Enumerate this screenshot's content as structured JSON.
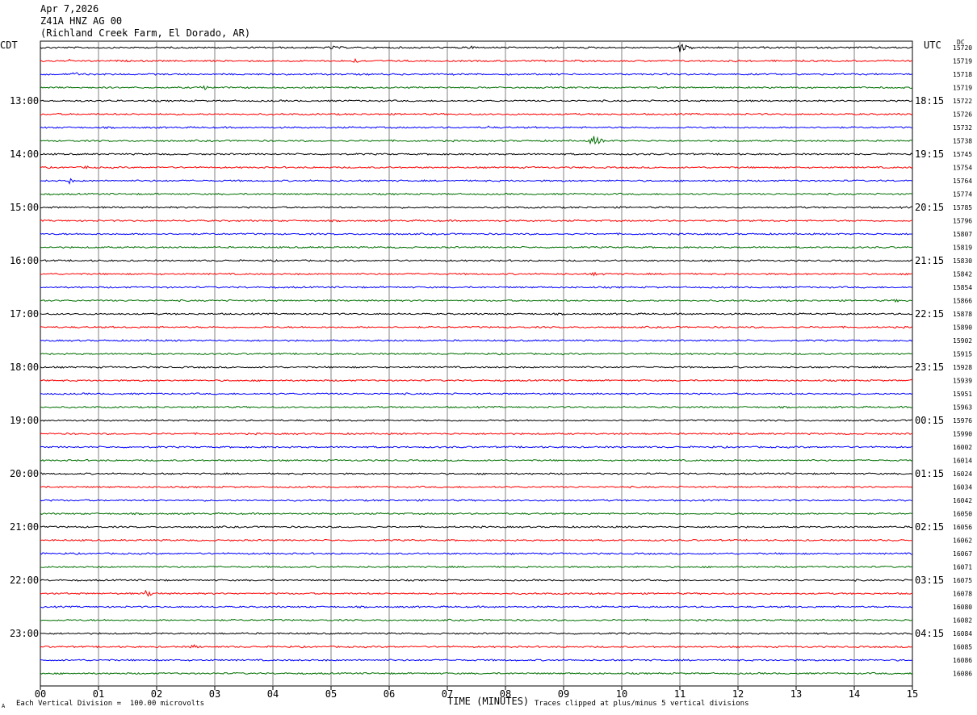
{
  "header": {
    "date": "Apr 7,2026",
    "station": "Z41A HNZ AG 00",
    "location": "(Richland Creek Farm, El Dorado, AR)"
  },
  "left_tz": "CDT",
  "right_tz": "UTC",
  "dc_label": "DC",
  "footer": {
    "scale": "Each Vertical Division =  100.00 microvolts",
    "xlabel": "TIME (MINUTES)",
    "clip": "Traces clipped at plus/minus 5 vertical divisions",
    "corner_mark": "A"
  },
  "colors": {
    "trace_cycle": [
      "#000000",
      "#ff0000",
      "#0000ff",
      "#007000"
    ],
    "grid": "#808080",
    "text": "#000000"
  },
  "chart_data": {
    "type": "line",
    "title": "",
    "xlabel": "TIME (MINUTES)",
    "ylabel": "",
    "xlim": [
      0,
      15
    ],
    "x_ticks": [
      "00",
      "01",
      "02",
      "03",
      "04",
      "05",
      "06",
      "07",
      "08",
      "09",
      "10",
      "11",
      "12",
      "13",
      "14",
      "15"
    ],
    "left_hour_labels": [
      "13:00",
      "14:00",
      "15:00",
      "16:00",
      "17:00",
      "18:00",
      "19:00",
      "20:00",
      "21:00",
      "22:00",
      "23:00"
    ],
    "right_hour_labels": [
      "18:15",
      "19:15",
      "20:15",
      "21:15",
      "22:15",
      "23:15",
      "00:15",
      "01:15",
      "02:15",
      "03:15",
      "04:15"
    ],
    "first_labeled_row": 4,
    "row_minutes": 15,
    "dc_values": [
      "15720",
      "15719",
      "15718",
      "15719",
      "15722",
      "15726",
      "15732",
      "15738",
      "15745",
      "15754",
      "15764",
      "15774",
      "15785",
      "15796",
      "15807",
      "15819",
      "15830",
      "15842",
      "15854",
      "15866",
      "15878",
      "15890",
      "15902",
      "15915",
      "15928",
      "15939",
      "15951",
      "15963",
      "15976",
      "15990",
      "16002",
      "16014",
      "16024",
      "16034",
      "16042",
      "16050",
      "16056",
      "16062",
      "16067",
      "16071",
      "16075",
      "16078",
      "16080",
      "16082",
      "16084",
      "16085",
      "16086",
      "16086"
    ],
    "events": [
      {
        "row": 0,
        "minute": 5.0,
        "amp": 2.5,
        "dur": 0.7
      },
      {
        "row": 0,
        "minute": 7.4,
        "amp": 3,
        "dur": 0.4
      },
      {
        "row": 0,
        "minute": 11.0,
        "amp": 6,
        "dur": 0.5
      },
      {
        "row": 1,
        "minute": 0.5,
        "amp": 2,
        "dur": 0.2
      },
      {
        "row": 1,
        "minute": 5.4,
        "amp": 3.5,
        "dur": 0.4
      },
      {
        "row": 1,
        "minute": 12.0,
        "amp": 3,
        "dur": 0.1
      },
      {
        "row": 2,
        "minute": 0.6,
        "amp": 4,
        "dur": 0.2
      },
      {
        "row": 3,
        "minute": 2.8,
        "amp": 3.5,
        "dur": 0.5
      },
      {
        "row": 6,
        "minute": 7.7,
        "amp": 3,
        "dur": 0.1
      },
      {
        "row": 7,
        "minute": 9.5,
        "amp": 8,
        "dur": 0.4
      },
      {
        "row": 9,
        "minute": 0.8,
        "amp": 3.5,
        "dur": 0.1
      },
      {
        "row": 9,
        "minute": 12.8,
        "amp": 2,
        "dur": 0.1
      },
      {
        "row": 10,
        "minute": 0.5,
        "amp": 4,
        "dur": 0.2
      },
      {
        "row": 17,
        "minute": 9.5,
        "amp": 2.5,
        "dur": 0.8
      },
      {
        "row": 19,
        "minute": 14.7,
        "amp": 2.5,
        "dur": 0.3
      },
      {
        "row": 41,
        "minute": 1.8,
        "amp": 4.5,
        "dur": 0.6
      },
      {
        "row": 45,
        "minute": 2.6,
        "amp": 3.5,
        "dur": 0.4
      }
    ]
  }
}
